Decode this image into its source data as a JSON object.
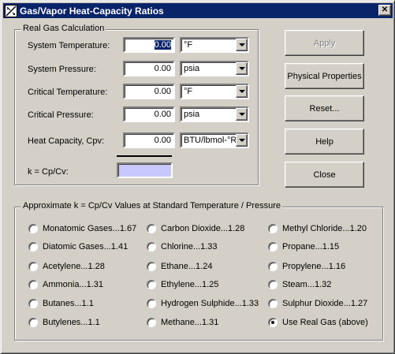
{
  "window": {
    "title": "Gas/Vapor Heat-Capacity Ratios",
    "close_glyph": "✕"
  },
  "real_gas": {
    "group_label": "Real Gas Calculation",
    "rows": [
      {
        "label": "System Temperature:",
        "value": "0.00",
        "unit": "°F"
      },
      {
        "label": "System Pressure:",
        "value": "0.00",
        "unit": "psia"
      },
      {
        "label": "Critical Temperature:",
        "value": "0.00",
        "unit": "°F"
      },
      {
        "label": "Critical Pressure:",
        "value": "0.00",
        "unit": "psia"
      },
      {
        "label": "Heat Capacity, Cpv:",
        "value": "0.00",
        "unit": "BTU/lbmol-°R"
      }
    ],
    "k_label": "k = Cp/Cv:",
    "k_value": ""
  },
  "buttons": {
    "apply": "Apply",
    "physical_properties": "Physical Properties",
    "reset": "Reset...",
    "help": "Help",
    "close": "Close"
  },
  "approx": {
    "group_label": "Approximate k = Cp/Cv Values at Standard Temperature / Pressure",
    "options": [
      [
        "Monatomic Gases...1.67",
        "Carbon Dioxide...1.28",
        "Methyl Chloride...1.20"
      ],
      [
        "Diatomic Gases...1.41",
        "Chlorine...1.33",
        "Propane...1.15"
      ],
      [
        "Acetylene...1.28",
        "Ethane...1.24",
        "Propylene...1.16"
      ],
      [
        "Ammonia...1.31",
        "Ethylene...1.25",
        "Steam...1.32"
      ],
      [
        "Butanes...1.1",
        "Hydrogen Sulphide...1.33",
        "Sulphur Dioxide...1.27"
      ],
      [
        "Butylenes...1.1",
        "Methane...1.31",
        "Use Real Gas (above)"
      ]
    ],
    "selected": "Use Real Gas (above)"
  },
  "colors": {
    "title_bar": "#0a246a",
    "k_result_fill": "#c8c8ff",
    "face": "#d4d0c8"
  }
}
